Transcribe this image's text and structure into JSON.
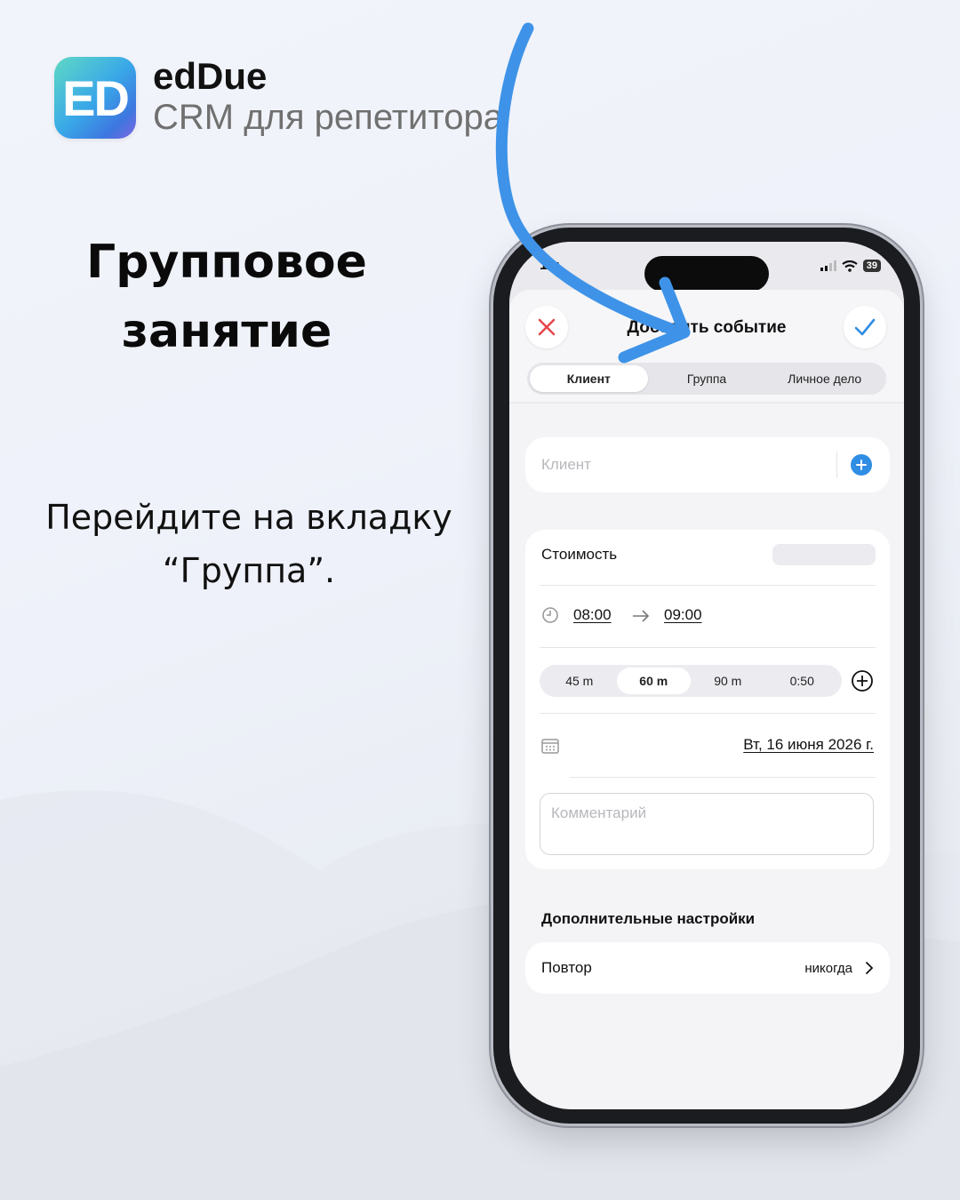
{
  "brand": {
    "logo_text": "ED",
    "name": "edDue",
    "tagline": "CRM для репетитора"
  },
  "headline": {
    "line1": "Групповое",
    "line2": "занятие"
  },
  "instruction": {
    "line1": "Перейдите на вкладку",
    "line2": "“Группа”."
  },
  "phone": {
    "status": {
      "time": "19:",
      "battery": "39"
    },
    "sheet": {
      "title": "Добавить событие",
      "close_icon": "close-icon",
      "confirm_icon": "check-icon",
      "tabs": [
        {
          "label": "Клиент",
          "active": true
        },
        {
          "label": "Группа",
          "active": false
        },
        {
          "label": "Личное дело",
          "active": false
        }
      ]
    },
    "client": {
      "placeholder": "Клиент",
      "add_icon": "plus-circle-icon"
    },
    "details": {
      "cost_label": "Стоимость",
      "start_time": "08:00",
      "end_time": "09:00",
      "durations": [
        {
          "label": "45 m",
          "active": false
        },
        {
          "label": "60 m",
          "active": true
        },
        {
          "label": "90 m",
          "active": false
        },
        {
          "label": "0:50",
          "active": false
        }
      ],
      "date": "Вт, 16 июня 2026 г.",
      "comment_placeholder": "Комментарий"
    },
    "extra": {
      "section_title": "Дополнительные настройки",
      "repeat_label": "Повтор",
      "repeat_value": "никогда"
    }
  },
  "colors": {
    "accent_blue": "#2f8de4",
    "close_red": "#e5484d",
    "arrow_blue": "#3e93e8"
  }
}
